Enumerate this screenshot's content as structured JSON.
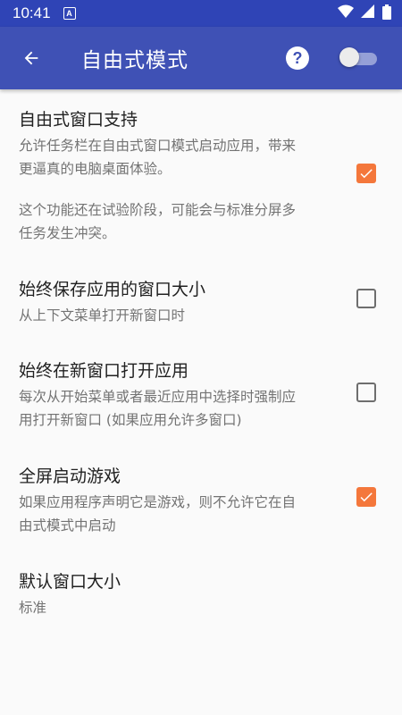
{
  "status_bar": {
    "time": "10:41",
    "notification_badge": "A",
    "icons": [
      "wifi-icon",
      "signal-icon",
      "battery-icon"
    ]
  },
  "toolbar": {
    "title": "自由式模式",
    "back_icon": "arrow-back-icon",
    "help_label": "?",
    "master_switch_on": false,
    "colors": {
      "primary": "#3f51b5",
      "primary_dark": "#2f44b6"
    }
  },
  "settings": {
    "freeform": {
      "title": "自由式窗口支持",
      "summary_line1": "允许任务栏在自由式窗口模式启动应用，带来",
      "summary_line2": "更逼真的电脑桌面体验。",
      "note_line1": "这个功能还在试验阶段，可能会与标准分屏多",
      "note_line2": "任务发生冲突。",
      "checked": true
    },
    "save_window_size": {
      "title": "始终保存应用的窗口大小",
      "summary": "从上下文菜单打开新窗口时",
      "checked": false
    },
    "open_new_window": {
      "title": "始终在新窗口打开应用",
      "summary_line1": "每次从开始菜单或者最近应用中选择时强制应",
      "summary_line2": "用打开新窗口 (如果应用允许多窗口)",
      "checked": false
    },
    "fullscreen_games": {
      "title": "全屏启动游戏",
      "summary_line1": "如果应用程序声明它是游戏，则不允许它在自",
      "summary_line2": "由式模式中启动",
      "checked": true
    },
    "default_window_size": {
      "title": "默认窗口大小",
      "value": "标准"
    }
  },
  "accent_color": "#f4773b"
}
